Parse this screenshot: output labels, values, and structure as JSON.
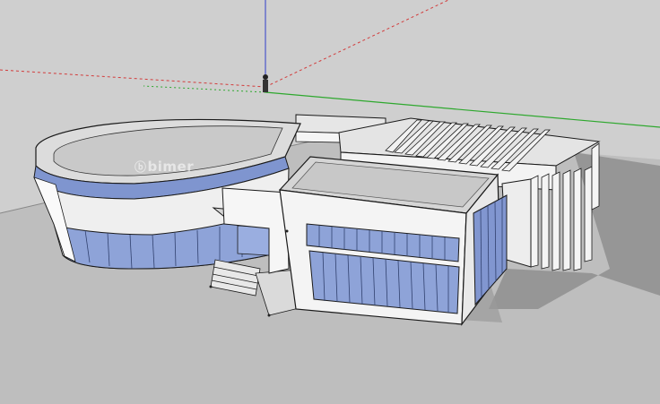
{
  "scene": {
    "watermark_text": "bimer",
    "colors": {
      "background": "#cfcfcf",
      "ground": "#bdbdbd",
      "wall": "#f2f2f2",
      "roof": "#d9d9d9",
      "shadow": "#8f8f8f",
      "glass": "#8ea3d8",
      "glass_dark": "#6f84c0",
      "edge": "#1a1a1a",
      "axis_red": "#d23c3c",
      "axis_green": "#2ea82e",
      "axis_blue": "#2f3cc8"
    },
    "icons": [
      "person-scale-figure-icon",
      "watermark-logo-icon"
    ]
  }
}
